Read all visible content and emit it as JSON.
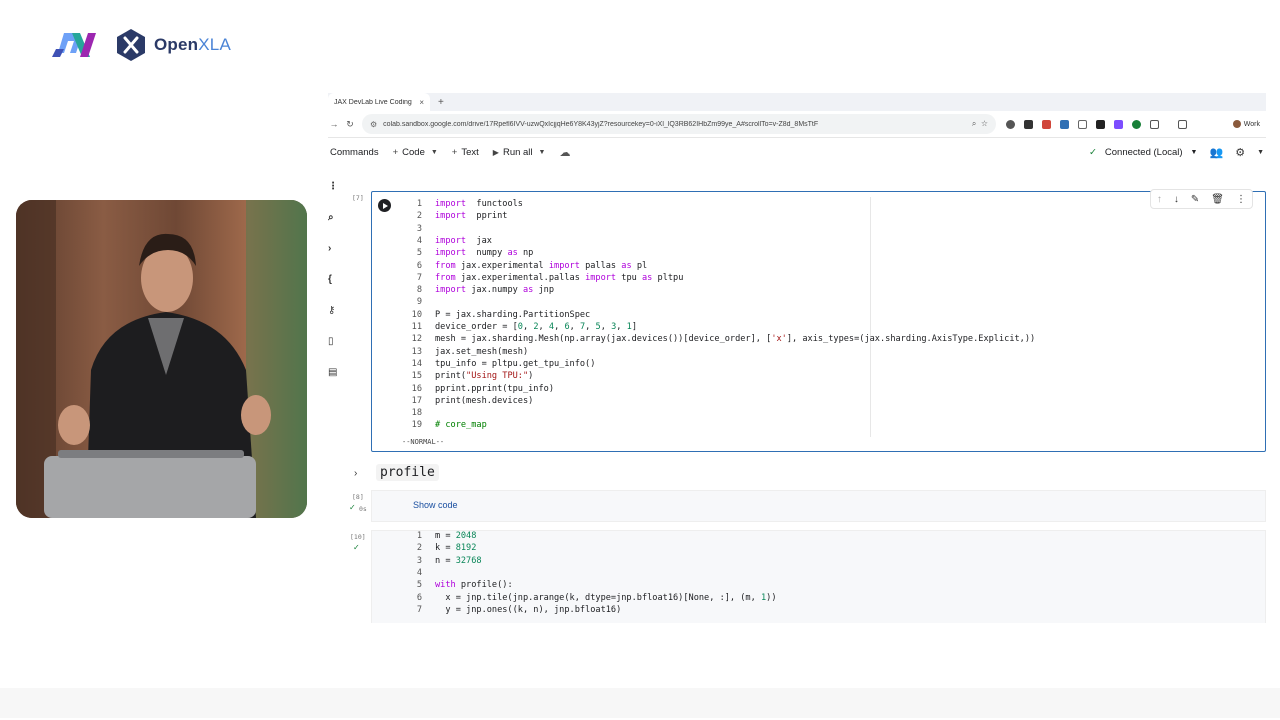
{
  "logos": {
    "jax_alt": "JAX",
    "openxla_text_main": "Open",
    "openxla_text_accent": "XLA"
  },
  "browser": {
    "tab_title": "JAX DevLab Live Coding",
    "tab_close": "×",
    "new_tab": "+",
    "url": "colab.sandbox.google.com/drive/17Rpefl6IVV-uzwQxIcjjqHe6Y8K43yjZ?resourcekey=0-iXl_lQ3RB62IHbZm99ye_A#scrollTo=v-Z8d_8MsTtF",
    "profile_label": "Work"
  },
  "toolbar": {
    "commands": "Commands",
    "code": "Code",
    "text": "Text",
    "run_all": "Run all",
    "status": "Connected (Local)"
  },
  "cells": [
    {
      "exec_count": "[7]",
      "mode": "--NORMAL--",
      "lines": [
        {
          "n": "1",
          "parts": [
            [
              "kw",
              "import"
            ],
            [
              "",
              "  functools"
            ]
          ]
        },
        {
          "n": "2",
          "parts": [
            [
              "kw",
              "import"
            ],
            [
              "",
              "  pprint"
            ]
          ]
        },
        {
          "n": "3",
          "parts": []
        },
        {
          "n": "4",
          "parts": [
            [
              "kw",
              "import"
            ],
            [
              "",
              "  jax"
            ]
          ]
        },
        {
          "n": "5",
          "parts": [
            [
              "kw",
              "import"
            ],
            [
              "",
              "  numpy "
            ],
            [
              "kw",
              "as"
            ],
            [
              "",
              " np"
            ]
          ]
        },
        {
          "n": "6",
          "parts": [
            [
              "kw",
              "from"
            ],
            [
              "",
              " jax.experimental "
            ],
            [
              "kw",
              "import"
            ],
            [
              "",
              " pallas "
            ],
            [
              "kw",
              "as"
            ],
            [
              "",
              " pl"
            ]
          ]
        },
        {
          "n": "7",
          "parts": [
            [
              "kw",
              "from"
            ],
            [
              "",
              " jax.experimental.pallas "
            ],
            [
              "kw",
              "import"
            ],
            [
              "",
              " tpu "
            ],
            [
              "kw",
              "as"
            ],
            [
              "",
              " pltpu"
            ]
          ]
        },
        {
          "n": "8",
          "parts": [
            [
              "kw",
              "import"
            ],
            [
              "",
              " jax.numpy "
            ],
            [
              "kw",
              "as"
            ],
            [
              "",
              " jnp"
            ]
          ]
        },
        {
          "n": "9",
          "parts": []
        },
        {
          "n": "10",
          "parts": [
            [
              "",
              "P = jax.sharding.PartitionSpec"
            ]
          ]
        },
        {
          "n": "11",
          "parts": [
            [
              "",
              "device_order = ["
            ],
            [
              "num",
              "0"
            ],
            [
              "",
              ", "
            ],
            [
              "num",
              "2"
            ],
            [
              "",
              ", "
            ],
            [
              "num",
              "4"
            ],
            [
              "",
              ", "
            ],
            [
              "num",
              "6"
            ],
            [
              "",
              ", "
            ],
            [
              "num",
              "7"
            ],
            [
              "",
              ", "
            ],
            [
              "num",
              "5"
            ],
            [
              "",
              ", "
            ],
            [
              "num",
              "3"
            ],
            [
              "",
              ", "
            ],
            [
              "num",
              "1"
            ],
            [
              "",
              "]"
            ]
          ]
        },
        {
          "n": "12",
          "parts": [
            [
              "",
              "mesh = jax.sharding.Mesh(np.array(jax.devices())[device_order], ["
            ],
            [
              "str",
              "'x'"
            ],
            [
              "",
              "], axis_types=(jax.sharding.AxisType.Explicit,))"
            ]
          ]
        },
        {
          "n": "13",
          "parts": [
            [
              "",
              "jax.set_mesh(mesh)"
            ]
          ]
        },
        {
          "n": "14",
          "parts": [
            [
              "",
              "tpu_info = pltpu.get_tpu_info()"
            ]
          ]
        },
        {
          "n": "15",
          "parts": [
            [
              "",
              "print("
            ],
            [
              "str",
              "\"Using TPU:\""
            ],
            [
              "",
              ")"
            ]
          ]
        },
        {
          "n": "16",
          "parts": [
            [
              "",
              "pprint.pprint(tpu_info)"
            ]
          ]
        },
        {
          "n": "17",
          "parts": [
            [
              "",
              "print(mesh.devices)"
            ]
          ]
        },
        {
          "n": "18",
          "parts": []
        },
        {
          "n": "19",
          "parts": [
            [
              "cm",
              "# core_map"
            ]
          ]
        }
      ]
    },
    {
      "section_title": "profile"
    },
    {
      "exec_count": "[8]",
      "exec_time": "0s",
      "show_code": "Show code"
    },
    {
      "exec_count": "[10]",
      "lines": [
        {
          "n": "1",
          "parts": [
            [
              "",
              "m = "
            ],
            [
              "num",
              "2048"
            ]
          ]
        },
        {
          "n": "2",
          "parts": [
            [
              "",
              "k = "
            ],
            [
              "num",
              "8192"
            ]
          ]
        },
        {
          "n": "3",
          "parts": [
            [
              "",
              "n = "
            ],
            [
              "num",
              "32768"
            ]
          ]
        },
        {
          "n": "4",
          "parts": []
        },
        {
          "n": "5",
          "parts": [
            [
              "kw",
              "with"
            ],
            [
              "",
              " profile():"
            ]
          ]
        },
        {
          "n": "6",
          "parts": [
            [
              "",
              "  x = jnp.tile(jnp.arange(k, dtype=jnp.bfloat16)[None, :], (m, "
            ],
            [
              "num",
              "1"
            ],
            [
              "",
              "))"
            ]
          ]
        },
        {
          "n": "7",
          "parts": [
            [
              "",
              "  y = jnp.ones((k, n), jnp.bfloat16)"
            ]
          ]
        }
      ]
    }
  ],
  "icons": {
    "run": "play-circle-icon",
    "move_up": "arrow-up-icon",
    "move_down": "arrow-down-icon",
    "edit": "pencil-icon",
    "delete": "trash-icon",
    "more": "more-vert-icon"
  },
  "colors": {
    "accent_blue": "#2f6fb4",
    "keyword": "#af00db",
    "number": "#098658",
    "string": "#a31515",
    "comment": "#008000",
    "success": "#188038"
  }
}
